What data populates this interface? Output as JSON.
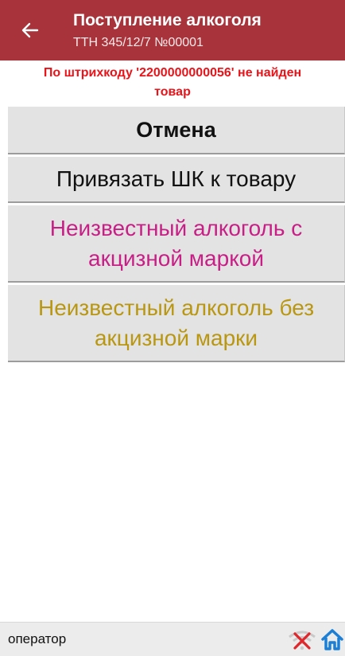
{
  "header": {
    "title": "Поступление алкоголя",
    "subtitle": "ТТН 345/12/7 №00001",
    "back_icon": "arrow-left-icon"
  },
  "message": {
    "line1": "По штрихкоду '2200000000056' не найден",
    "line2": "товар",
    "color": "#e8141a"
  },
  "buttons": {
    "cancel": "Отмена",
    "bind": "Привязать ШК к товару",
    "excise_line1": "Неизвестный алкоголь с",
    "excise_line2": "акцизной маркой",
    "noexcise_line1": "Неизвестный алкоголь без",
    "noexcise_line2": "акцизной марки"
  },
  "colors": {
    "header": "#a8333a",
    "excise_text": "#c71f86",
    "noexcise_text": "#b99712"
  },
  "footer": {
    "operator": "оператор",
    "status_icons": [
      "wifi-off-icon",
      "home-icon"
    ]
  }
}
